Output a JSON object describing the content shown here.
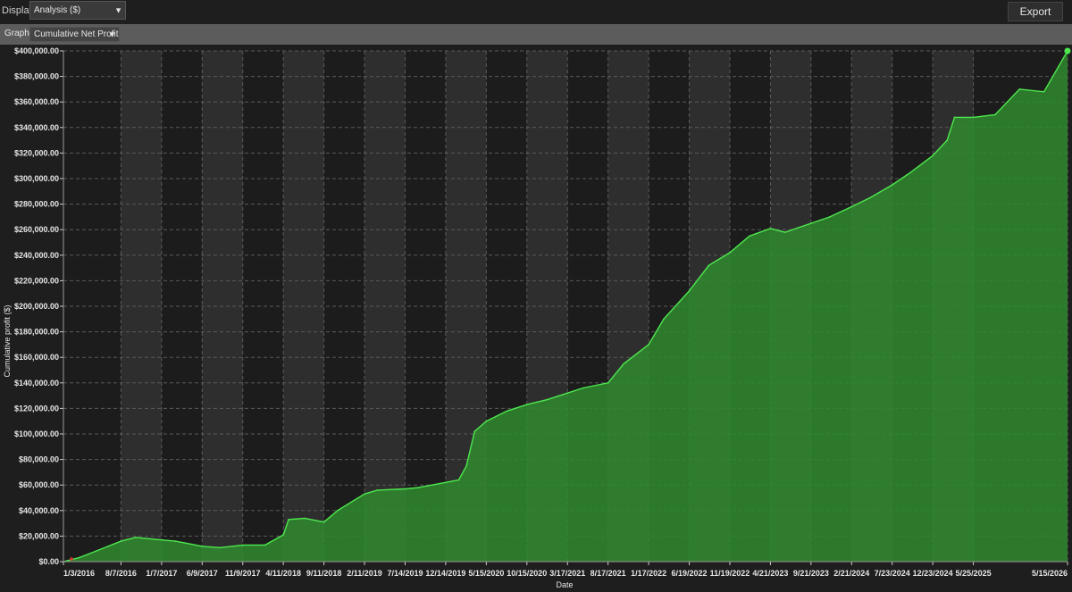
{
  "toolbar": {
    "display_label": "Display",
    "display_value": "Analysis ($)",
    "export_label": "Export"
  },
  "graph_bar": {
    "graph_label": "Graph",
    "graph_value": "Cumulative Net Profit"
  },
  "colors": {
    "fill": "#2f8a2f",
    "line": "#4ee84e",
    "band": "#2e2e2e",
    "background": "#1c1c1c"
  },
  "chart_data": {
    "type": "area",
    "xlabel": "Date",
    "ylabel": "Cumulative profit ($)",
    "ylim": [
      0,
      400000
    ],
    "y_ticks": [
      "$0.00",
      "$20,000.00",
      "$40,000.00",
      "$60,000.00",
      "$80,000.00",
      "$100,000.00",
      "$120,000.00",
      "$140,000.00",
      "$160,000.00",
      "$180,000.00",
      "$200,000.00",
      "$220,000.00",
      "$240,000.00",
      "$260,000.00",
      "$280,000.00",
      "$300,000.00",
      "$320,000.00",
      "$340,000.00",
      "$360,000.00",
      "$380,000.00",
      "$400,000.00"
    ],
    "x_ticks": [
      "1/3/2016",
      "8/7/2016",
      "1/7/2017",
      "6/9/2017",
      "11/9/2017",
      "4/11/2018",
      "9/11/2018",
      "2/11/2019",
      "7/14/2019",
      "12/14/2019",
      "5/15/2020",
      "10/15/2020",
      "3/17/2021",
      "8/17/2021",
      "1/17/2022",
      "6/19/2022",
      "11/19/2022",
      "4/21/2023",
      "9/21/2023",
      "2/21/2024",
      "7/23/2024",
      "12/23/2024",
      "5/25/2025",
      "5/15/2026"
    ],
    "grid": true,
    "x": [
      "1/3/2016",
      "3/1/2016",
      "5/1/2016",
      "8/7/2016",
      "10/1/2016",
      "1/7/2017",
      "3/1/2017",
      "6/9/2017",
      "8/15/2017",
      "11/9/2017",
      "2/1/2018",
      "4/11/2018",
      "5/1/2018",
      "7/1/2018",
      "9/11/2018",
      "11/1/2018",
      "2/11/2019",
      "4/1/2019",
      "7/14/2019",
      "9/1/2019",
      "12/14/2019",
      "2/1/2020",
      "3/1/2020",
      "4/1/2020",
      "5/15/2020",
      "8/1/2020",
      "10/15/2020",
      "1/1/2021",
      "3/17/2021",
      "5/15/2021",
      "8/17/2021",
      "10/15/2021",
      "1/17/2022",
      "3/15/2022",
      "6/19/2022",
      "9/1/2022",
      "11/19/2022",
      "2/1/2023",
      "4/21/2023",
      "6/15/2023",
      "9/21/2023",
      "12/1/2023",
      "2/21/2024",
      "5/1/2024",
      "7/23/2024",
      "10/1/2024",
      "12/23/2024",
      "2/15/2025",
      "3/15/2025",
      "5/25/2025",
      "8/15/2025",
      "11/15/2025",
      "2/15/2026",
      "5/15/2026"
    ],
    "values": [
      0,
      3000,
      8000,
      16000,
      19000,
      17000,
      16000,
      12000,
      11000,
      13000,
      13000,
      21000,
      33000,
      34000,
      31000,
      40000,
      53000,
      56000,
      57000,
      58000,
      62000,
      64000,
      75000,
      102000,
      110000,
      118000,
      123000,
      127000,
      132000,
      136000,
      140000,
      155000,
      170000,
      190000,
      212000,
      232000,
      242000,
      255000,
      261000,
      258000,
      265000,
      270000,
      278000,
      285000,
      295000,
      305000,
      318000,
      330000,
      348000,
      348000,
      350000,
      370000,
      368000,
      400000
    ]
  }
}
